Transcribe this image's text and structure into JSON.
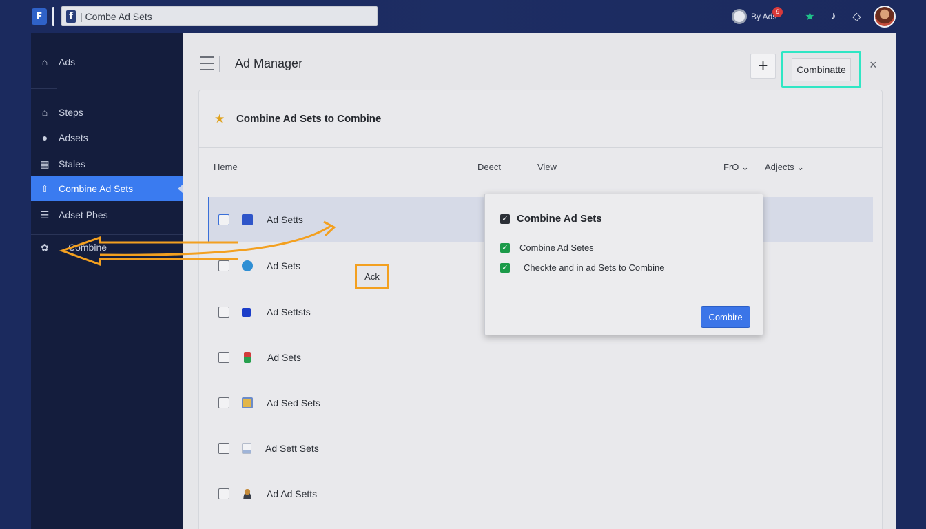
{
  "browser": {
    "logo_glyph": "F",
    "fb_glyph": "f",
    "address": "| Combe Ad Sets"
  },
  "top_right": {
    "profile_label": "By Ads",
    "badge": "9"
  },
  "sidebar": {
    "items": [
      {
        "label": "Ads",
        "icon": "home-icon"
      },
      {
        "label": "Steps",
        "icon": "steps-icon"
      },
      {
        "label": "Adsets",
        "icon": "circle-icon"
      },
      {
        "label": "Stales",
        "icon": "grid-icon"
      },
      {
        "label": "Combine Ad Sets",
        "icon": "combine-icon"
      },
      {
        "label": "Adset Pbes",
        "icon": "list-icon"
      },
      {
        "label": "Combine",
        "icon": "settings-icon"
      }
    ],
    "active_color": "#3a7bf0"
  },
  "header": {
    "title": "Ad Manager",
    "plus_label": "+",
    "combine_label": "Combinatte",
    "close_label": "×"
  },
  "panel": {
    "title": "Combine Ad Sets to Combine",
    "columns": {
      "home": "Heme",
      "deect": "Deect",
      "view": "View",
      "fro": "FrO ⌄",
      "adjects": "Adjects ⌄"
    },
    "rows": [
      {
        "label": "Ad Setts",
        "icon_color": "#2f55c9"
      },
      {
        "label": "Ad Sets",
        "icon_color": "#2f8fd4"
      },
      {
        "label": "Ad Settsts",
        "icon_color": "#1c3ec9"
      },
      {
        "label": "Ad Sets",
        "icon_color": "#d23c3c"
      },
      {
        "label": "Ad Sed Sets",
        "icon_color": "#e2b64a"
      },
      {
        "label": "Ad Sett Sets",
        "icon_color": "#9fb4d8"
      },
      {
        "label": "Ad Ad Setts",
        "icon_color": "#c48a3a"
      }
    ],
    "ask_tag": "Ack"
  },
  "dialog": {
    "title": "Combine Ad Sets",
    "line1": "Combine Ad Setes",
    "line2": "Checkte and in ad Sets to Combine",
    "button": "Combire"
  },
  "colors": {
    "highlight_teal": "#2fe6c4",
    "highlight_orange": "#f3a020",
    "primary_blue": "#3b75e8"
  }
}
